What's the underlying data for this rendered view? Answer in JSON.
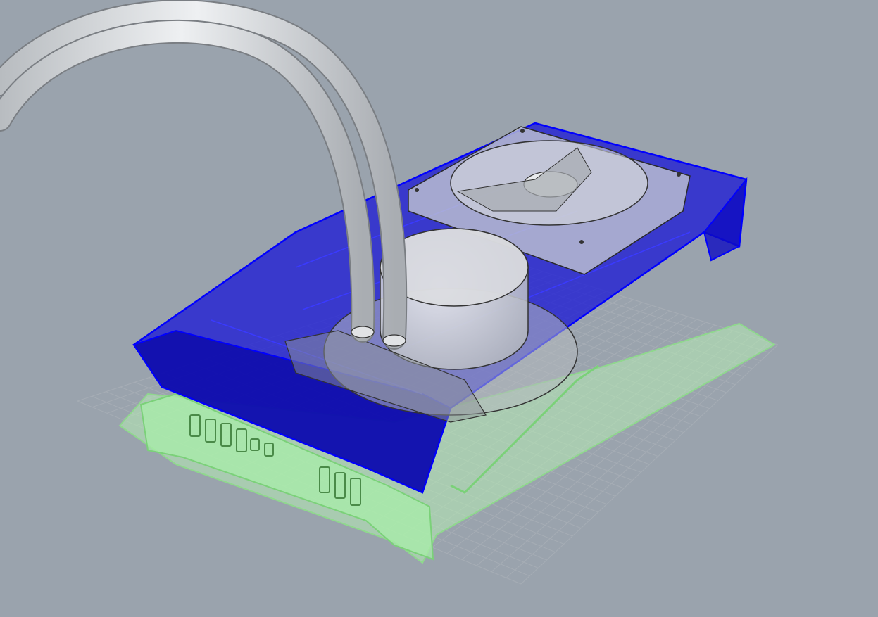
{
  "viewport": {
    "background": "#9aa3ad",
    "grid_color": "#b9c0c7",
    "grid_line_color": "#a6adb5"
  },
  "model": {
    "objects": [
      {
        "name": "gpu-shroud",
        "selected": true,
        "color": "#0a0fd0"
      },
      {
        "name": "pcb-bracket",
        "selected": false,
        "color": "#a8f0a8"
      },
      {
        "name": "radiator-fan",
        "selected": false,
        "color": "#c9cdd2"
      },
      {
        "name": "pump-block",
        "selected": false,
        "color": "#d7d9dc"
      },
      {
        "name": "coolant-tubes",
        "selected": false,
        "color": "#d2d5d8"
      }
    ]
  }
}
